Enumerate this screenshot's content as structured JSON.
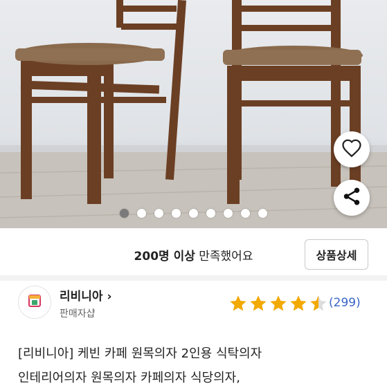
{
  "product_images": {
    "image_alt": "product-photo-wooden-chairs",
    "pagination": {
      "total": 9,
      "active_index": 0
    }
  },
  "actions": {
    "wishlist_icon": "heart-icon",
    "share_icon": "share-icon"
  },
  "satisfaction": {
    "strong_text": "200명 이상",
    "rest_text": " 만족했어요"
  },
  "detail_button": {
    "label": "상품상세"
  },
  "seller": {
    "name": "리비니아",
    "chevron": "›",
    "type": "판매자샵",
    "logo_icon": "store-icon"
  },
  "rating": {
    "stars": 4.5,
    "max": 5,
    "review_count": "(299)",
    "star_color": "#f2a900"
  },
  "product": {
    "title_line1": "[리비니아] 케빈 카페 원목의자 2인용 식탁의자",
    "title_line2": "인테리어의자 원목의자 카페의자 식당의자,"
  },
  "colors": {
    "accent_blue": "#3a64c8",
    "divider": "#f2f2f2"
  }
}
